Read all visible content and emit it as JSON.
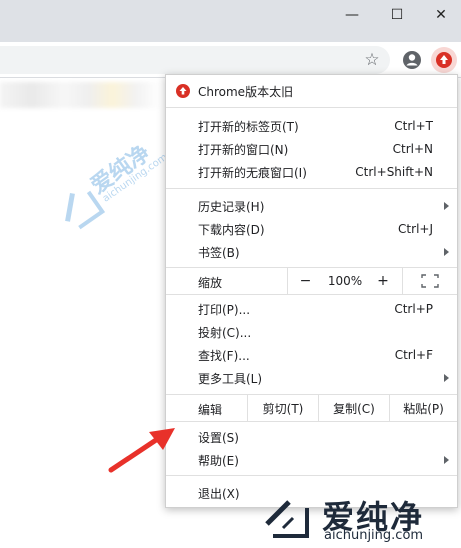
{
  "window": {
    "minimize_glyph": "—",
    "maximize_glyph": "☐",
    "close_glyph": "✕"
  },
  "toolbar": {
    "star_glyph": "☆"
  },
  "menu": {
    "update": {
      "label": "Chrome版本太旧"
    },
    "group1": [
      {
        "label": "打开新的标签页(T)",
        "shortcut": "Ctrl+T"
      },
      {
        "label": "打开新的窗口(N)",
        "shortcut": "Ctrl+N"
      },
      {
        "label": "打开新的无痕窗口(I)",
        "shortcut": "Ctrl+Shift+N"
      }
    ],
    "group2": [
      {
        "label": "历史记录(H)",
        "shortcut": ""
      },
      {
        "label": "下载内容(D)",
        "shortcut": "Ctrl+J"
      },
      {
        "label": "书签(B)",
        "shortcut": ""
      }
    ],
    "zoom": {
      "label": "缩放",
      "minus": "−",
      "value": "100%",
      "plus": "+"
    },
    "group3": [
      {
        "label": "打印(P)...",
        "shortcut": "Ctrl+P"
      },
      {
        "label": "投射(C)...",
        "shortcut": ""
      },
      {
        "label": "查找(F)...",
        "shortcut": "Ctrl+F"
      },
      {
        "label": "更多工具(L)",
        "shortcut": ""
      }
    ],
    "edit": {
      "label": "编辑",
      "cut": "剪切(T)",
      "copy": "复制(C)",
      "paste": "粘贴(P)"
    },
    "group4": [
      {
        "label": "设置(S)"
      },
      {
        "label": "帮助(E)"
      }
    ],
    "exit": {
      "label": "退出(X)"
    }
  },
  "watermark": {
    "cn": "爱纯净",
    "en": "aichunjing.com",
    "faint_cn": "爱纯净",
    "faint_en": "aichunjing.com"
  },
  "colors": {
    "accent_red": "#d93025",
    "arrow_red": "#e8312a"
  }
}
